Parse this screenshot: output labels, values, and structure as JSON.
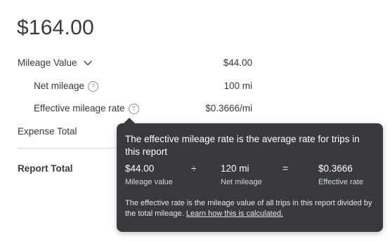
{
  "summary": {
    "total_amount": "$164.00"
  },
  "rows": {
    "mileage_value": {
      "label": "Mileage Value",
      "value": "$44.00"
    },
    "net_mileage": {
      "label": "Net mileage",
      "value": "100 mi",
      "help_glyph": "?"
    },
    "effective_rate": {
      "label": "Effective mileage rate",
      "value": "$0.3666/mi",
      "help_glyph": "?"
    },
    "expense_total": {
      "label": "Expense Total"
    },
    "report_total": {
      "label": "Report Total"
    }
  },
  "tooltip": {
    "title": "The effective mileage rate is the average rate for trips in this report",
    "calc": [
      {
        "value": "$44.00",
        "caption": "Mileage value"
      },
      {
        "value": "120 mi",
        "caption": "Net mileage"
      },
      {
        "value": "$0.3666",
        "caption": "Effective rate"
      }
    ],
    "operators": {
      "divide": "÷",
      "equals": "="
    },
    "description": "The effective rate is the mileage value of all trips in this report divided by the total mileage.",
    "link_text": "Learn how this is calculated."
  },
  "icons": {
    "chevron": "chevron-down-icon",
    "help": "help-circle-icon"
  },
  "colors": {
    "text": "#393a3d",
    "tooltip_bg": "#393a3d",
    "divider": "#dcdcdc"
  }
}
